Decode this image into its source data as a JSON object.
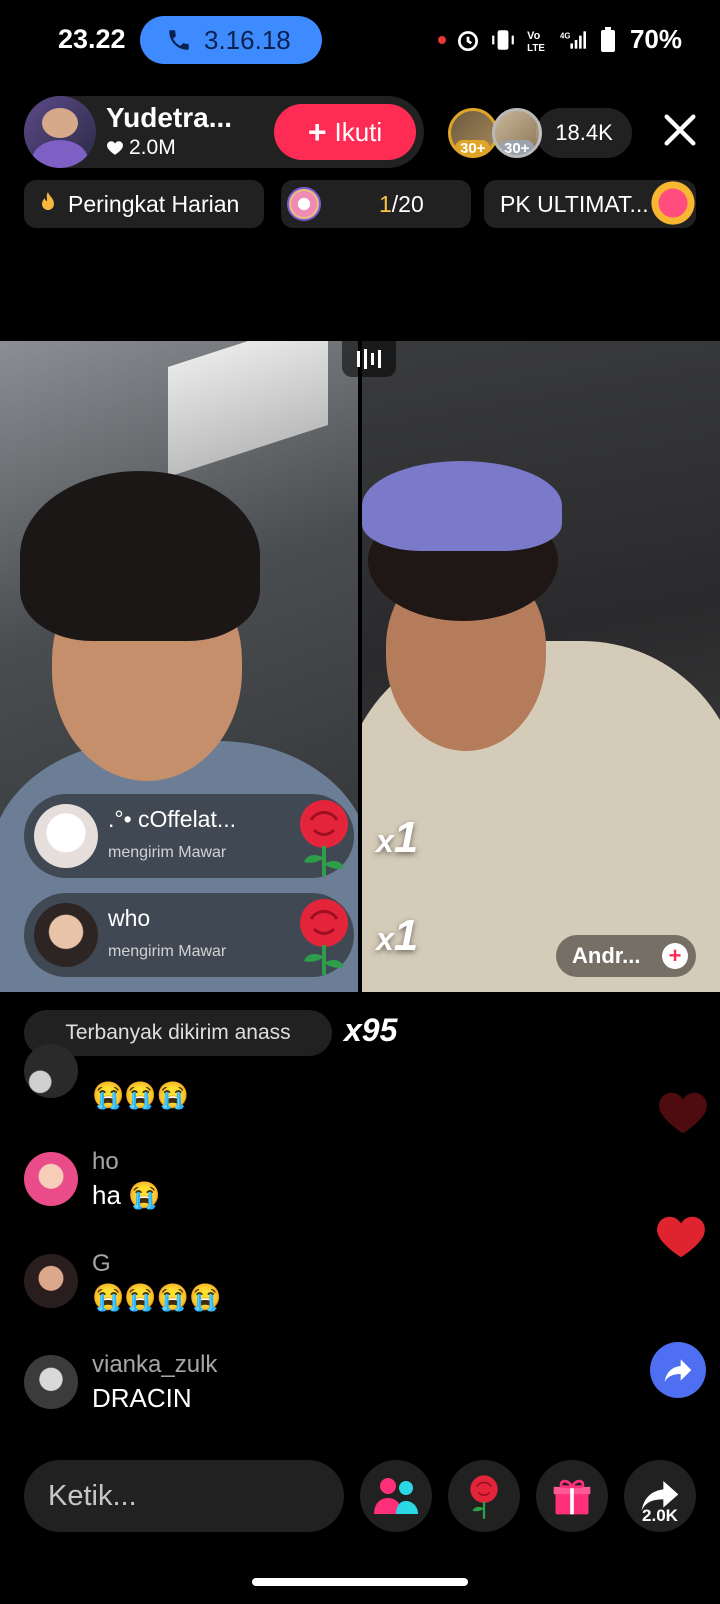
{
  "status_bar": {
    "time": "23.22",
    "call_timer": "3.16.18",
    "battery": "70%",
    "icons": [
      "record-dot-icon",
      "alarm-icon",
      "vibrate-icon",
      "volte-icon",
      "4g-signal-icon",
      "battery-icon"
    ]
  },
  "host": {
    "name": "Yudetra...",
    "likes": "2.0M",
    "follow_label": "Ikuti"
  },
  "viewers": {
    "badges": [
      "30+",
      "30+"
    ],
    "count": "18.4K"
  },
  "chips": {
    "rank_label": "Peringkat Harian",
    "donut_current": "1",
    "donut_total": "/20",
    "pk_label": "PK ULTIMAT..."
  },
  "gifts": [
    {
      "name": ".°• cOffelat...",
      "action": "mengirim Mawar",
      "combo": "1"
    },
    {
      "name": "who",
      "action": "mengirim Mawar",
      "combo": "1"
    }
  ],
  "combo_prefix": "x",
  "guest": {
    "name": "Andr..."
  },
  "top_sender": {
    "label": "Terbanyak dikirim anass",
    "count": "x95"
  },
  "chat": [
    {
      "user": "",
      "message": "😭😭😭"
    },
    {
      "user": "ho",
      "message": "ha 😭"
    },
    {
      "user": "G",
      "message": "😭😭😭😭"
    },
    {
      "user": "vianka_zulk",
      "message": "DRACIN"
    }
  ],
  "bottom_bar": {
    "input_placeholder": "Ketik...",
    "share_count": "2.0K"
  },
  "colors": {
    "accent": "#fe2c55",
    "call_pill": "#3d8bff",
    "share_float": "#4e6ff2"
  }
}
